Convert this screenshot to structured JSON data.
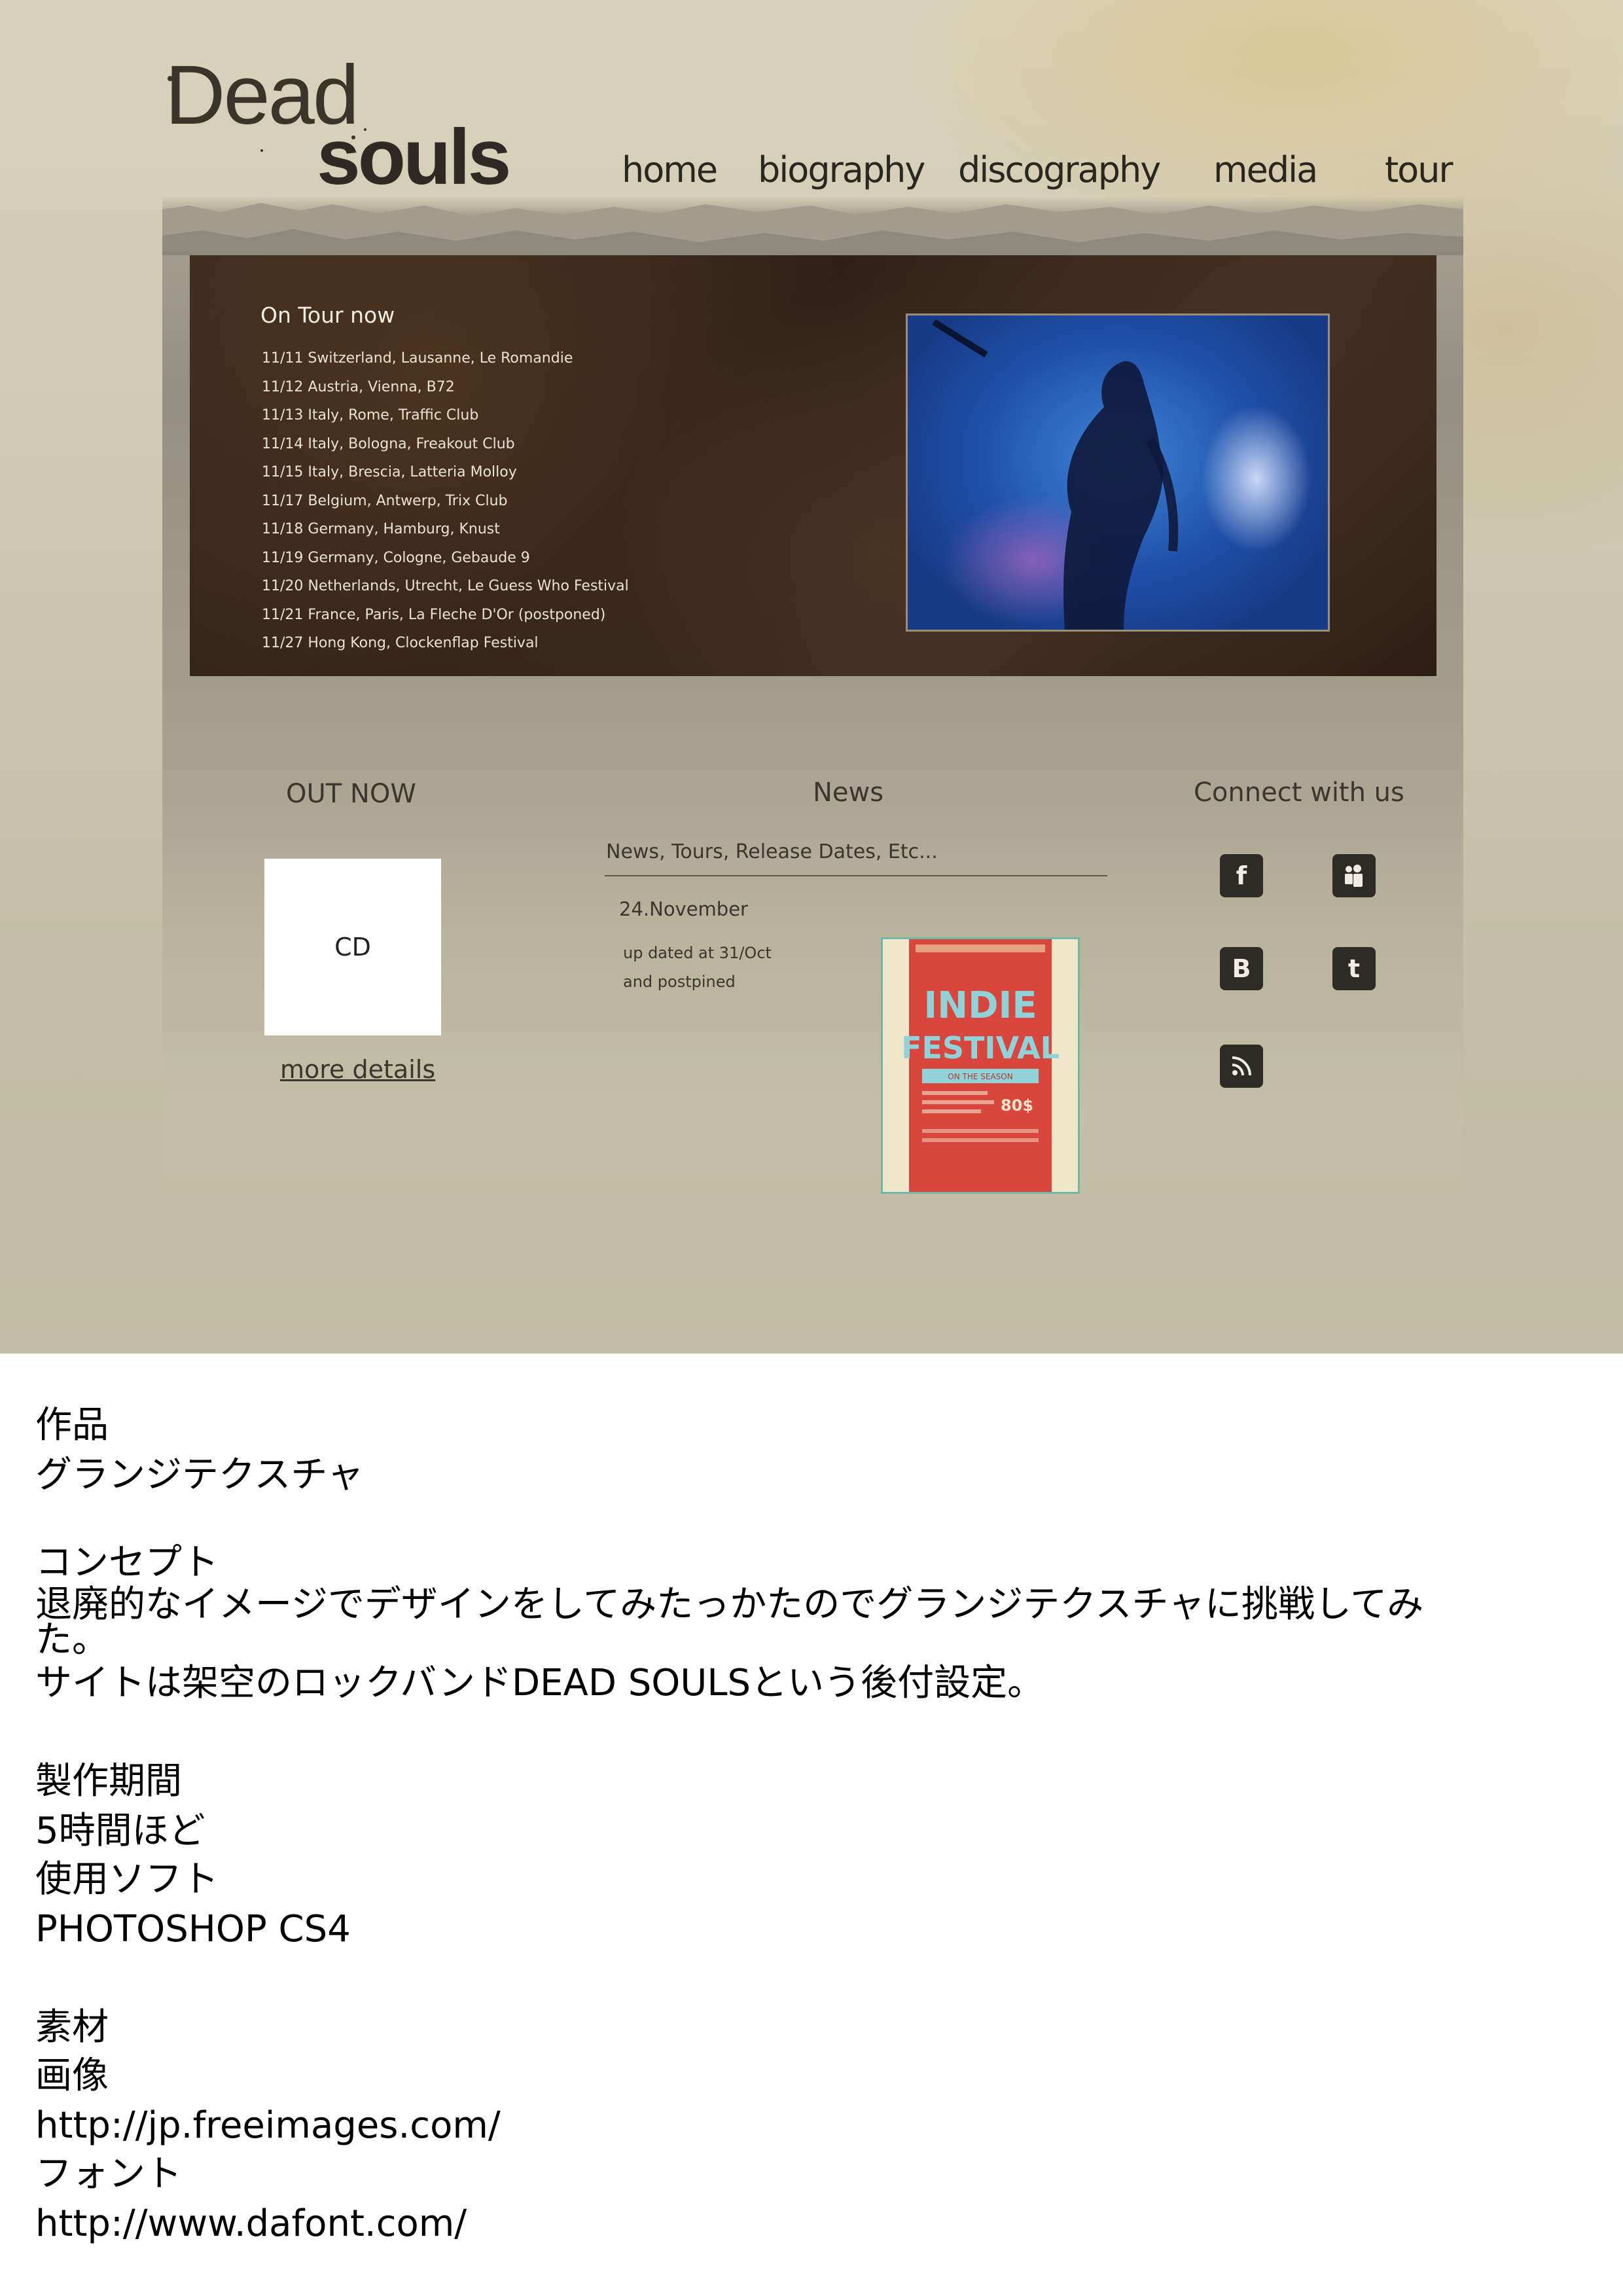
{
  "site": {
    "logo": {
      "line1": "Dead",
      "line2": "souls"
    },
    "nav": [
      "home",
      "biography",
      "discography",
      "media",
      "tour"
    ],
    "tour": {
      "title": "On Tour now",
      "dates": [
        "11/11 Switzerland, Lausanne, Le Romandie",
        "11/12 Austria, Vienna, B72",
        "11/13 Italy, Rome, Traffic Club",
        "11/14 Italy, Bologna, Freakout Club",
        "11/15 Italy, Brescia, Latteria Molloy",
        "11/17 Belgium, Antwerp, Trix Club",
        "11/18 Germany, Hamburg, Knust",
        "11/19 Germany, Cologne, Gebaude 9",
        "11/20 Netherlands, Utrecht, Le Guess Who Festival",
        "11/21 France, Paris, La Fleche D'Or (postponed)",
        "11/27 Hong Kong, Clockenflap Festival"
      ]
    },
    "out_now": {
      "title": "OUT NOW",
      "cd_label": "CD",
      "link": "more details"
    },
    "news": {
      "title": "News",
      "tabs": "News, Tours, Release Dates, Etc...",
      "date": "24.November",
      "body_line1": "up dated at 31/Oct",
      "body_line2": "and postpined",
      "poster": {
        "title_line1": "INDIE",
        "title_line2": "FESTIVAL",
        "tag": "ON THE SEASON",
        "price": "80$"
      }
    },
    "connect": {
      "title": "Connect with us",
      "icons": [
        "facebook-icon",
        "myspace-icon",
        "blogger-icon",
        "twitter-icon",
        "rss-icon"
      ]
    }
  },
  "notes": {
    "work_heading": "作品",
    "work_title": "グランジテクスチャ",
    "concept_heading": "コンセプト",
    "concept_line1": "退廃的なイメージでデザインをしてみたっかたのでグランジテクスチャに挑戦してみ",
    "concept_line2": "た。",
    "concept_line3": "サイトは架空のロックバンドDEAD SOULSという後付設定。",
    "period_heading": "製作期間",
    "period_value": "5時間ほど",
    "software_heading": "使用ソフト",
    "software_value": "PHOTOSHOP CS4",
    "materials_heading": "素材",
    "images_heading": "画像",
    "images_url": "http://jp.freeimages.com/",
    "fonts_heading": "フォント",
    "fonts_url": "http://www.dafont.com/"
  },
  "colors": {
    "background": "#c8c2aa",
    "hero_bg": "#2e2018",
    "text_dark": "#2a2620",
    "poster_red": "#d9463e",
    "poster_teal": "#6fb7a7"
  }
}
